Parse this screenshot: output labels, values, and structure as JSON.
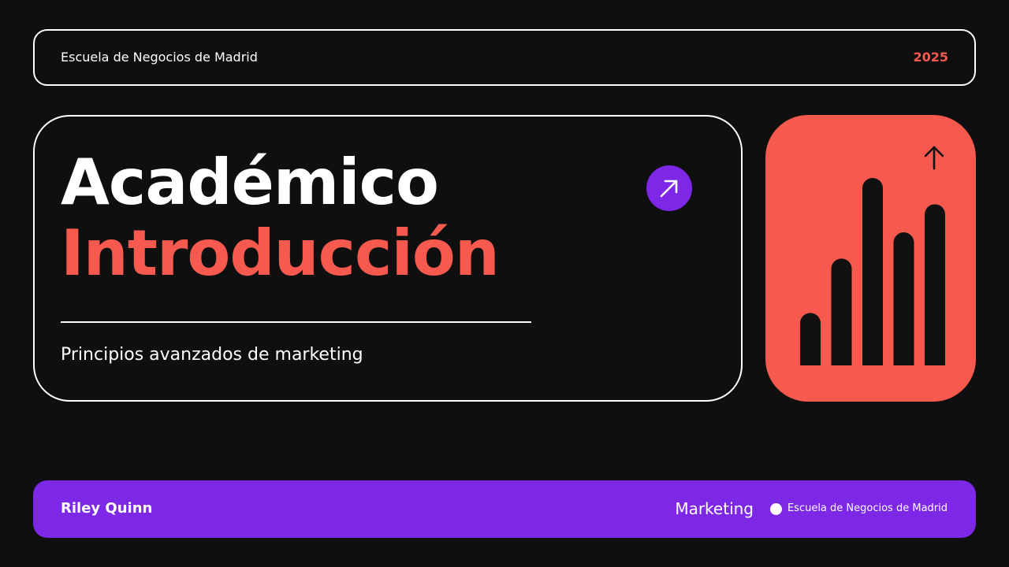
{
  "header": {
    "organization": "Escuela de Negocios de Madrid",
    "year": "2025"
  },
  "hero": {
    "title_line1": "Académico",
    "title_line2": "Introducción",
    "subtitle": "Principios avanzados de marketing",
    "action_icon": "arrow-up-right-icon"
  },
  "graphic": {
    "icon": "bar-chart-icon",
    "trend_icon": "arrow-up-icon",
    "bar_levels": [
      0.28,
      0.57,
      1.0,
      0.71,
      0.86
    ]
  },
  "footer": {
    "author": "Riley Quinn",
    "department": "Marketing",
    "school": "Escuela de Negocios de Madrid"
  },
  "colors": {
    "background": "#0f0f10",
    "coral": "#f65a4e",
    "purple": "#7c28e6",
    "white": "#ffffff",
    "bar": "#111111"
  }
}
